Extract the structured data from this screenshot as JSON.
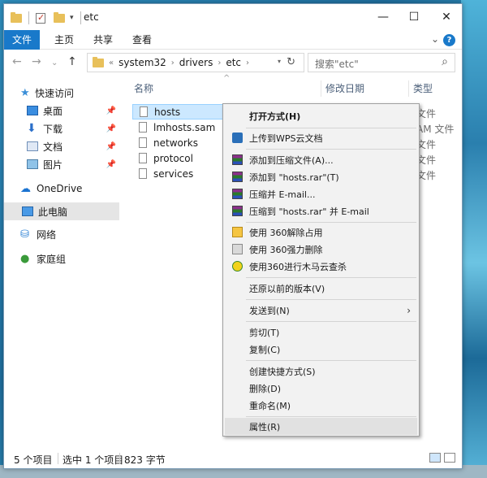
{
  "window": {
    "title": "etc",
    "controls": {
      "minimize": "—",
      "maximize": "☐",
      "close": "✕"
    }
  },
  "ribbon": {
    "tabs": [
      {
        "label": "文件",
        "active": true
      },
      {
        "label": "主页",
        "active": false
      },
      {
        "label": "共享",
        "active": false
      },
      {
        "label": "查看",
        "active": false
      }
    ],
    "help_label": "?"
  },
  "addressbar": {
    "back_icon": "arrow-left-icon",
    "forward_icon": "arrow-right-icon",
    "path_prefix": "«",
    "crumbs": [
      "system32",
      "drivers",
      "etc"
    ],
    "search_placeholder": "搜索\"etc\""
  },
  "sidebar": {
    "quick_access": "快速访问",
    "items": [
      {
        "label": "桌面",
        "pinned": true
      },
      {
        "label": "下载",
        "pinned": true
      },
      {
        "label": "文档",
        "pinned": true
      },
      {
        "label": "图片",
        "pinned": true
      }
    ],
    "onedrive": "OneDrive",
    "this_pc": "此电脑",
    "network": "网络",
    "homegroup": "家庭组"
  },
  "filelist": {
    "columns": {
      "name": "名称",
      "modified": "修改日期",
      "type": "类型"
    },
    "files": [
      {
        "name": "hosts",
        "type": "文件",
        "selected": true
      },
      {
        "name": "lmhosts.sam",
        "type": "AM 文件",
        "selected": false
      },
      {
        "name": "networks",
        "type": "文件",
        "selected": false
      },
      {
        "name": "protocol",
        "type": "文件",
        "selected": false
      },
      {
        "name": "services",
        "type": "文件",
        "selected": false
      }
    ]
  },
  "statusbar": {
    "item_count": "5 个项目",
    "selected": "选中 1 个项目",
    "size": "823 字节"
  },
  "context_menu": {
    "items": [
      {
        "label": "打开方式(H)",
        "bold": true,
        "icon": ""
      },
      {
        "label": "上传到WPS云文档",
        "icon": "wps-icon"
      },
      {
        "label": "添加到压缩文件(A)...",
        "icon": "winrar-icon"
      },
      {
        "label": "添加到 \"hosts.rar\"(T)",
        "icon": "winrar-icon"
      },
      {
        "label": "压缩并 E-mail...",
        "icon": "winrar-icon"
      },
      {
        "label": "压缩到 \"hosts.rar\" 并 E-mail",
        "icon": "winrar-icon"
      },
      {
        "label": "使用 360解除占用",
        "icon": "360-unlock-icon"
      },
      {
        "label": "使用 360强力删除",
        "icon": "360-shred-icon"
      },
      {
        "label": "使用360进行木马云查杀",
        "icon": "360-scan-icon"
      },
      {
        "label": "还原以前的版本(V)",
        "icon": ""
      },
      {
        "label": "发送到(N)",
        "icon": "",
        "submenu": true
      },
      {
        "label": "剪切(T)",
        "icon": ""
      },
      {
        "label": "复制(C)",
        "icon": ""
      },
      {
        "label": "创建快捷方式(S)",
        "icon": ""
      },
      {
        "label": "删除(D)",
        "icon": ""
      },
      {
        "label": "重命名(M)",
        "icon": ""
      },
      {
        "label": "属性(R)",
        "icon": "",
        "highlighted": true
      }
    ]
  }
}
